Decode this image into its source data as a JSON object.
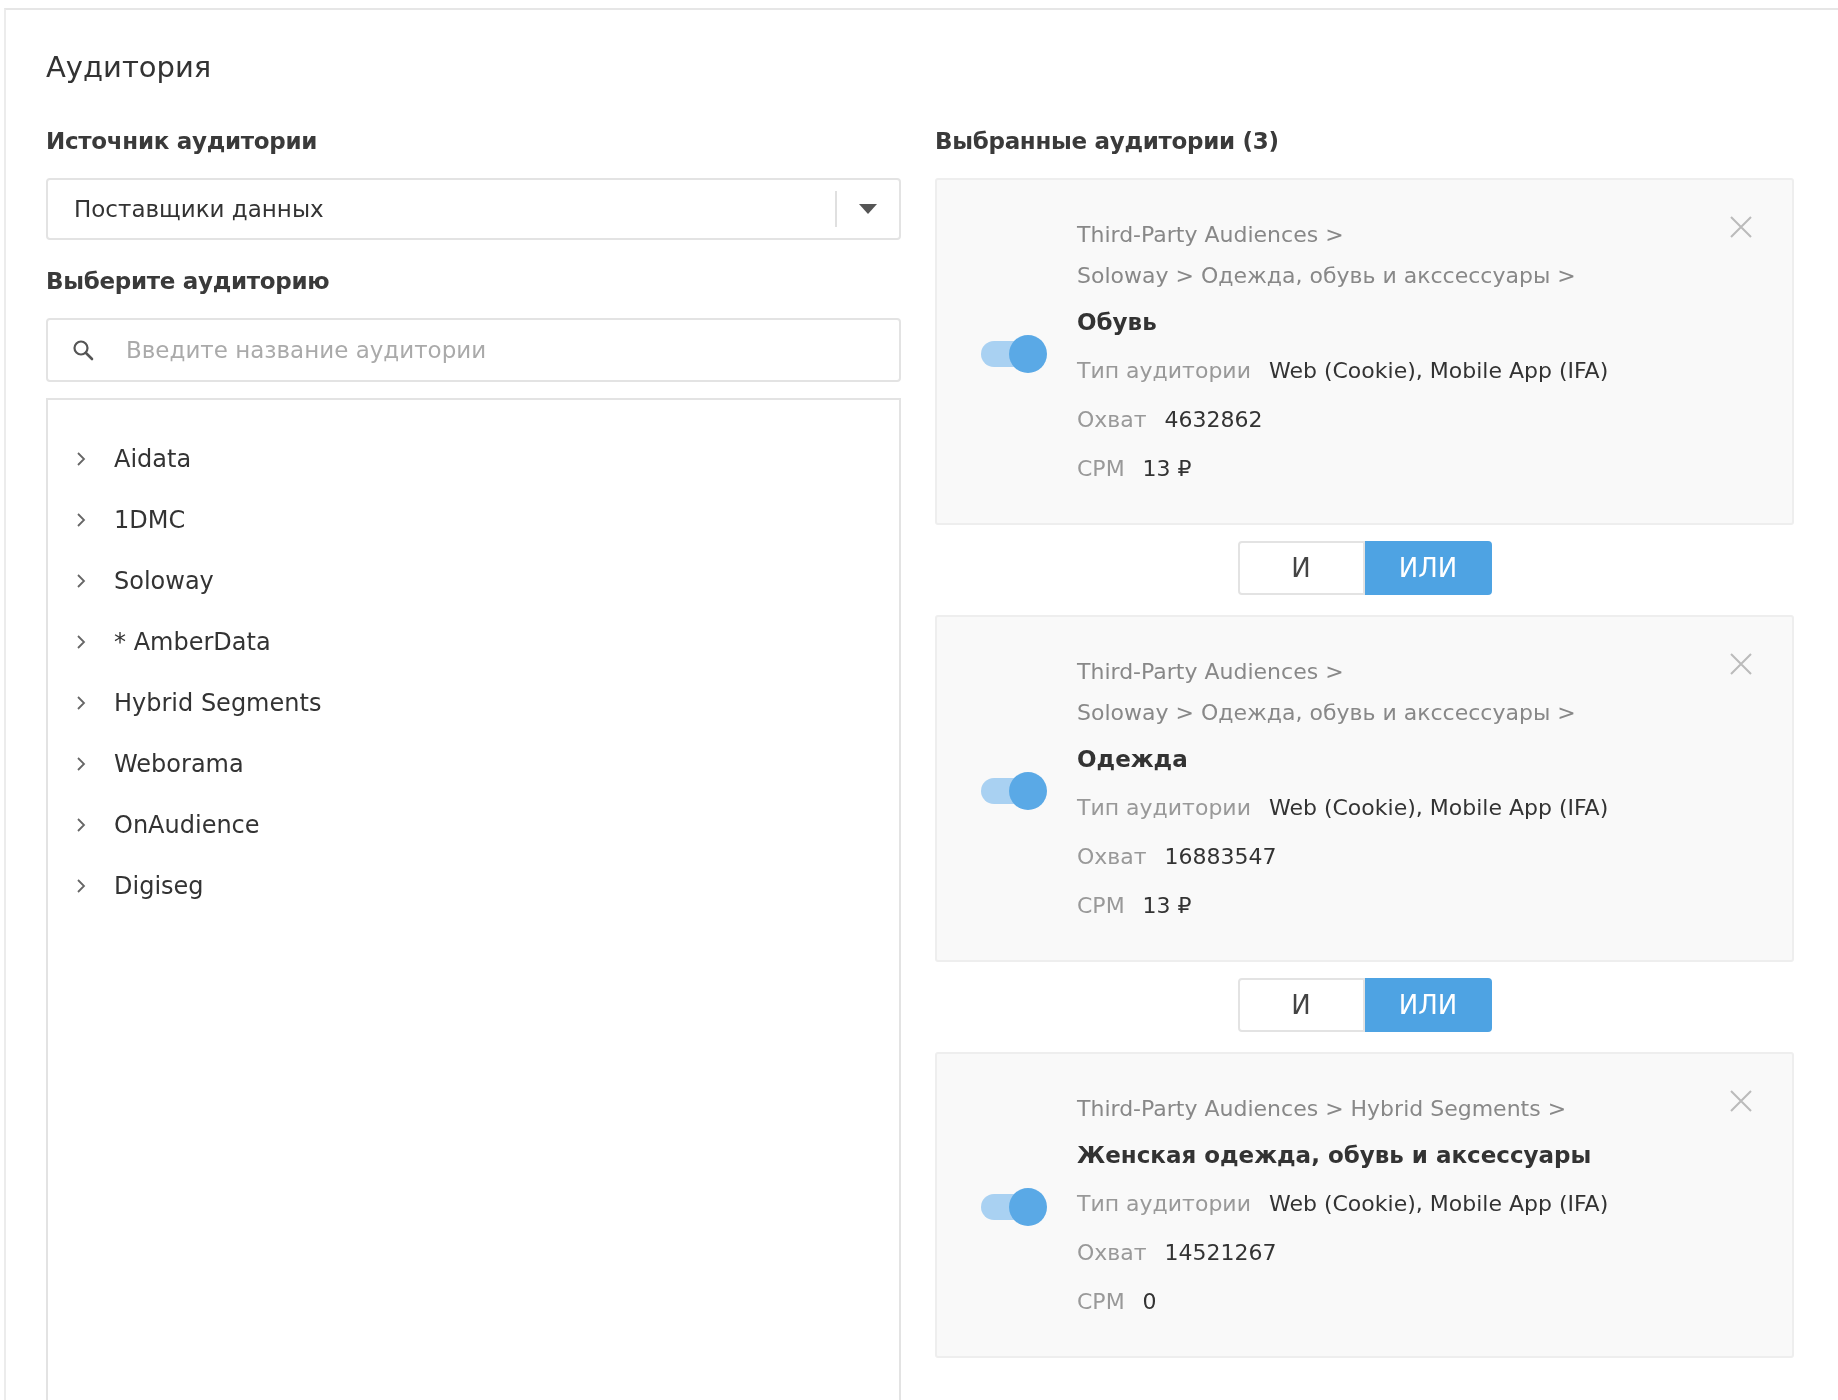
{
  "title": "Аудитория",
  "source": {
    "label": "Источник аудитории",
    "value": "Поставщики данных"
  },
  "picker": {
    "label": "Выберите аудиторию",
    "placeholder": "Введите название аудитории",
    "tree": [
      {
        "label": "Aidata",
        "expanded": false
      },
      {
        "label": "1DMC",
        "expanded": false
      },
      {
        "label": "Soloway",
        "expanded": false
      },
      {
        "label": "* AmberData",
        "expanded": false
      },
      {
        "label": "Hybrid Segments",
        "expanded": false
      },
      {
        "label": "Weborama",
        "expanded": false
      },
      {
        "label": "OnAudience",
        "expanded": false
      },
      {
        "label": "Digiseg",
        "expanded": false
      }
    ]
  },
  "selected": {
    "title": "Выбранные аудитории (3)",
    "items": [
      {
        "kind": "card",
        "path": [
          "Third-Party Audiences >",
          "Soloway > Одежда, обувь и акссессуары >"
        ],
        "name": "Обувь",
        "on": true,
        "type_label": "Тип аудитории",
        "type": "Web (Cookie), Mobile App (IFA)",
        "reach_label": "Охват",
        "reach": "4632862",
        "cpm_label": "CPM",
        "cpm": "13 ₽"
      },
      {
        "kind": "operator",
        "options": [
          {
            "label": "И",
            "selected": false
          },
          {
            "label": "ИЛИ",
            "selected": true
          }
        ]
      },
      {
        "kind": "card",
        "path": [
          "Third-Party Audiences >",
          "Soloway > Одежда, обувь и акссессуары >"
        ],
        "name": "Одежда",
        "on": true,
        "type_label": "Тип аудитории",
        "type": "Web (Cookie), Mobile App (IFA)",
        "reach_label": "Охват",
        "reach": "16883547",
        "cpm_label": "CPM",
        "cpm": "13 ₽"
      },
      {
        "kind": "operator",
        "options": [
          {
            "label": "И",
            "selected": false
          },
          {
            "label": "ИЛИ",
            "selected": true
          }
        ]
      },
      {
        "kind": "card",
        "path": [
          "Third-Party Audiences > Hybrid Segments >"
        ],
        "name": "Женская одежда, обувь и аксессуары",
        "on": true,
        "type_label": "Тип аудитории",
        "type": "Web (Cookie), Mobile App (IFA)",
        "reach_label": "Охват",
        "reach": "14521267",
        "cpm_label": "CPM",
        "cpm": "0"
      }
    ]
  }
}
